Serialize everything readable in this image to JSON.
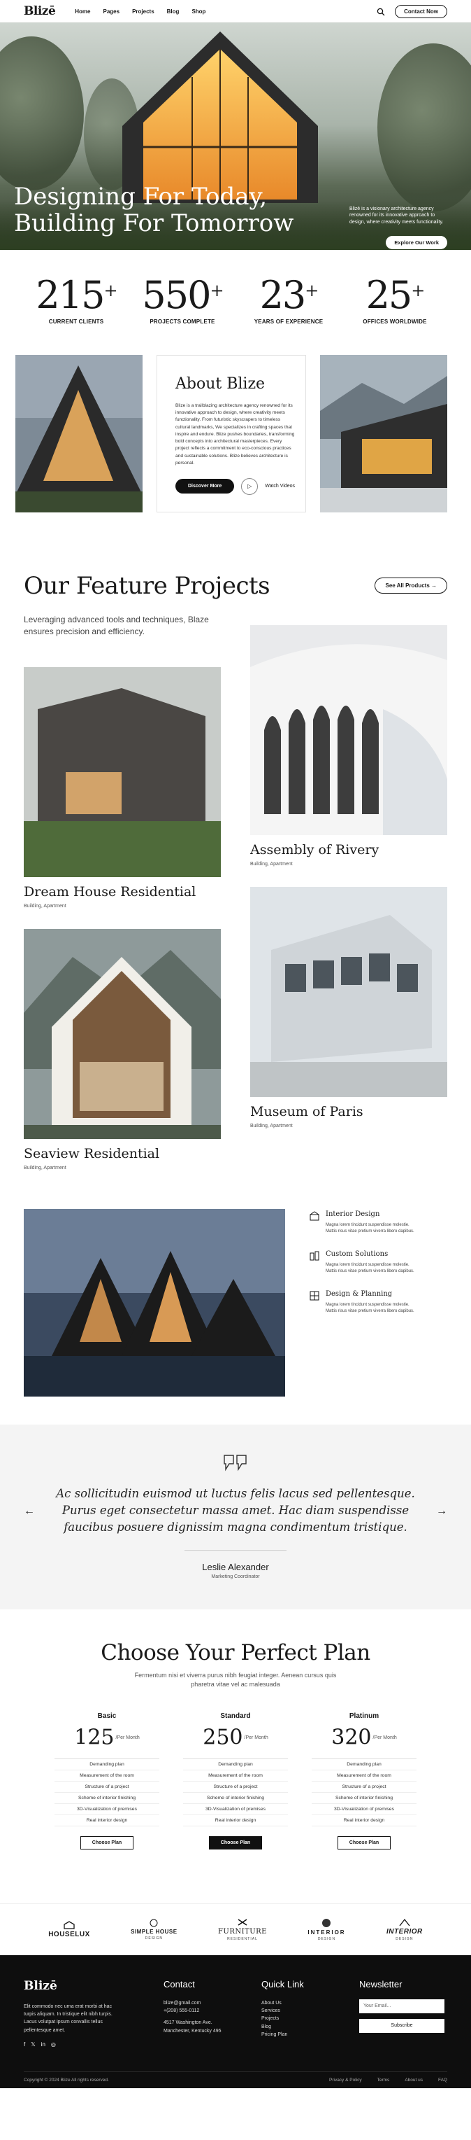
{
  "header": {
    "logo": "Blizē",
    "nav": [
      "Home",
      "Pages",
      "Projects",
      "Blog",
      "Shop"
    ],
    "contact_label": "Contact Now"
  },
  "hero": {
    "line1": "Designing For Today,",
    "line2": "Building For Tomorrow",
    "blurb": "Blizē is a visionary architecture agency renowned for its innovative approach to design, where creativity meets functionality.",
    "cta": "Explore Our Work"
  },
  "stats": [
    {
      "num": "215",
      "label": "CURRENT CLIENTS"
    },
    {
      "num": "550",
      "label": "PROJECTS COMPLETE"
    },
    {
      "num": "23",
      "label": "YEARS OF EXPERIENCE"
    },
    {
      "num": "25",
      "label": "OFFICES WORLDWIDE"
    }
  ],
  "about": {
    "title": "About Blize",
    "text": "Blize is a trailblazing architecture agency renowned for its innovative approach to design, where creativity meets functionality. From futuristic skyscrapers to timeless cultural landmarks, We specializes in crafting spaces that inspire and endure. Blize pushes boundaries, transforming bold concepts into architectural masterpieces. Every project reflects a commitment to eco-conscious practices and sustainable solutions. Blize believes architecture is personal.",
    "discover": "Discover More",
    "watch": "Watch Videos"
  },
  "projects": {
    "title": "Our Feature Projects",
    "subtitle": "Leveraging advanced tools and techniques, Blaze ensures precision and efficiency.",
    "see_all": "See All Products",
    "items": [
      {
        "name": "Dream House Residential",
        "cat": "Building, Apartment"
      },
      {
        "name": "Assembly of Rivery",
        "cat": "Building, Apartment"
      },
      {
        "name": "Seaview Residential",
        "cat": "Building, Apartment"
      },
      {
        "name": "Museum of Paris",
        "cat": "Building, Apartment"
      }
    ]
  },
  "features": [
    {
      "title": "Interior Design",
      "text": "Magna lorem tincidunt suspendisse molestie. Mattis risus vitae pretium viverra libero dapibus."
    },
    {
      "title": "Custom Solutions",
      "text": "Magna lorem tincidunt suspendisse molestie. Mattis risus vitae pretium viverra libero dapibus."
    },
    {
      "title": "Design & Planning",
      "text": "Magna lorem tincidunt suspendisse molestie. Mattis risus vitae pretium viverra libero dapibus."
    }
  ],
  "testimonial": {
    "quote": "Ac sollicitudin euismod ut luctus felis lacus sed pellentesque. Purus eget consectetur massa amet. Hac diam suspendisse faucibus posuere dignissim magna condimentum tristique.",
    "name": "Leslie Alexander",
    "role": "Marketing Coordinator",
    "prev": "←",
    "next": "→"
  },
  "pricing": {
    "title": "Choose Your Perfect Plan",
    "subtitle": "Fermentum nisi et viverra purus nibh feugiat integer. Aenean cursus quis pharetra vitae vel ac malesuada",
    "plans": [
      {
        "name": "Basic",
        "price": "125",
        "unit": "/Per Month",
        "features": [
          "Demanding plan",
          "Measurement of the room",
          "Structure of a project",
          "Scheme of interior finishing",
          "3D-Visualization of premises",
          "Real interior design"
        ],
        "cta": "Choose Plan"
      },
      {
        "name": "Standard",
        "price": "250",
        "unit": "/Per Month",
        "features": [
          "Demanding plan",
          "Measurement of the room",
          "Structure of a project",
          "Scheme of interior finishing",
          "3D-Visualization of premises",
          "Real interior design"
        ],
        "cta": "Choose Plan"
      },
      {
        "name": "Platinum",
        "price": "320",
        "unit": "/Per Month",
        "features": [
          "Demanding plan",
          "Measurement of the room",
          "Structure of a project",
          "Scheme of interior finishing",
          "3D-Visualization of premises",
          "Real interior design"
        ],
        "cta": "Choose Plan"
      }
    ]
  },
  "brands": [
    {
      "name": "HOUSELUX",
      "sub": ""
    },
    {
      "name": "SIMPLE HOUSE",
      "sub": "DESIGN"
    },
    {
      "name": "FURNITURE",
      "sub": "RESIDENTIAL"
    },
    {
      "name": "INTERIOR",
      "sub": "DESIGN"
    },
    {
      "name": "INTERIOR",
      "sub": "DESIGN"
    }
  ],
  "footer": {
    "logo": "Blizē",
    "about": "Elit commodo nec urna erat morbi at hac turpis aliquam. In tristique elit nibh turpis. Lacus volutpat ipsum convallis tellus pellentesque amet.",
    "contact_title": "Contact",
    "email": "blize@gmail.com",
    "phone": "+(208) 555-0112",
    "address": "4517 Washington Ave. Manchester, Kentucky 495",
    "quick_title": "Quick Link",
    "quick": [
      "About Us",
      "Services",
      "Projects",
      "Blog",
      "Pricing Plan"
    ],
    "news_title": "Newsletter",
    "email_placeholder": "Your Email...",
    "subscribe": "Subscribe",
    "copyright": "Copyright © 2024 Blize All rights reserved.",
    "links": [
      "Privacy & Policy",
      "Terms",
      "About us",
      "FAQ"
    ]
  },
  "colors": {
    "accent": "#111111",
    "hero_glow": "#f2a33a"
  }
}
